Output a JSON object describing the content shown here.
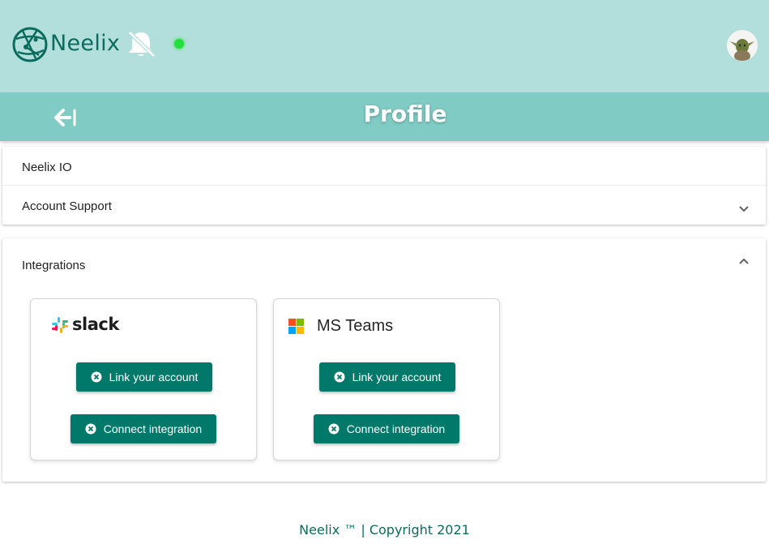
{
  "header": {
    "brand": "Neelix",
    "logo_icon": "globe-network-icon",
    "notification_icon": "bell-off-icon",
    "status": "online",
    "status_color": "#22e03a",
    "avatar_icon": "user-avatar"
  },
  "titlebar": {
    "title": "Profile",
    "back_icon": "arrow-left-bar-icon"
  },
  "sections": {
    "neelix_io": "Neelix IO",
    "account_support": "Account Support",
    "integrations": "Integrations"
  },
  "integrations": [
    {
      "name": "slack",
      "icon": "slack-icon",
      "link_label": "Link your account",
      "connect_label": "Connect integration"
    },
    {
      "name": "MS Teams",
      "icon": "microsoft-icon",
      "link_label": "Link your account",
      "connect_label": "Connect integration"
    }
  ],
  "footer": {
    "text": "Neelix ™ | Copyright 2021"
  },
  "colors": {
    "topbar": "#b2dfdb",
    "titlebar": "#80cbc4",
    "button": "#00796b",
    "brand_text": "#0b6b5e"
  }
}
